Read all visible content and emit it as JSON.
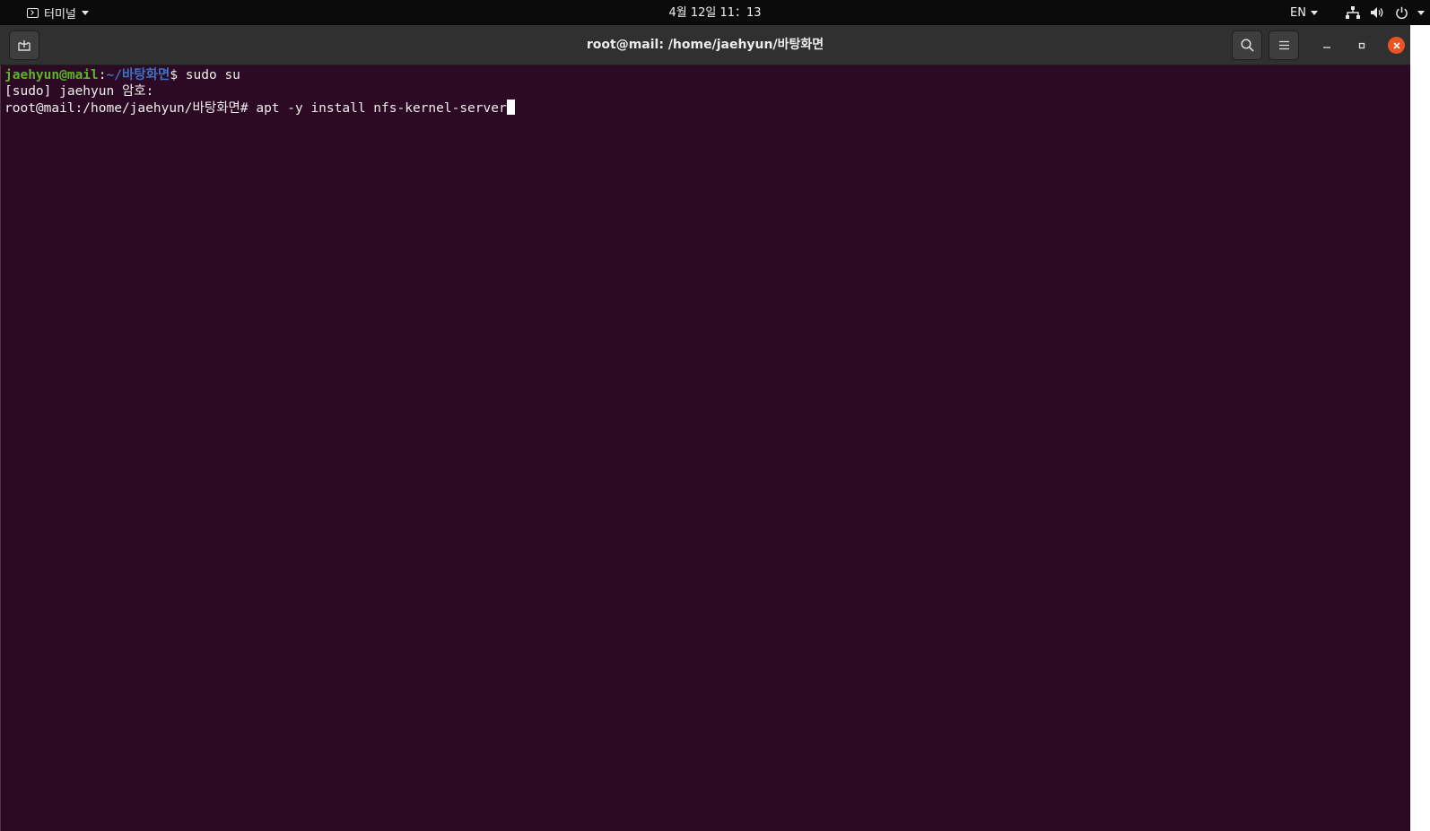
{
  "topbar": {
    "app_menu_label": "터미널",
    "clock": "4월 12일  11：13",
    "input_language": "EN"
  },
  "window": {
    "title": "root@mail: /home/jaehyun/바탕화면"
  },
  "terminal": {
    "line1": {
      "user_host": "jaehyun@mail",
      "separator": ":",
      "path": "~/바탕화면",
      "prompt_symbol": "$ ",
      "command": "sudo su"
    },
    "line2": {
      "text": "[sudo] jaehyun 암호: "
    },
    "line3": {
      "prompt": "root@mail:/home/jaehyun/바탕화면# ",
      "command": "apt -y install nfs-kernel-server"
    }
  },
  "icons": {
    "app_menu": "terminal-icon",
    "new_tab": "new-tab-icon",
    "search": "search-icon",
    "menu": "hamburger-icon",
    "minimize": "minimize-icon",
    "maximize": "maximize-icon",
    "close": "close-icon",
    "network": "network-icon",
    "volume": "volume-icon",
    "power": "power-icon"
  },
  "colors": {
    "terminal_background": "#2c0a24",
    "user_host_green": "#5bb52a",
    "path_blue": "#3f71c2",
    "close_button_orange": "#e95420",
    "headerbar": "#303030",
    "topbar": "#0b0b0b"
  }
}
